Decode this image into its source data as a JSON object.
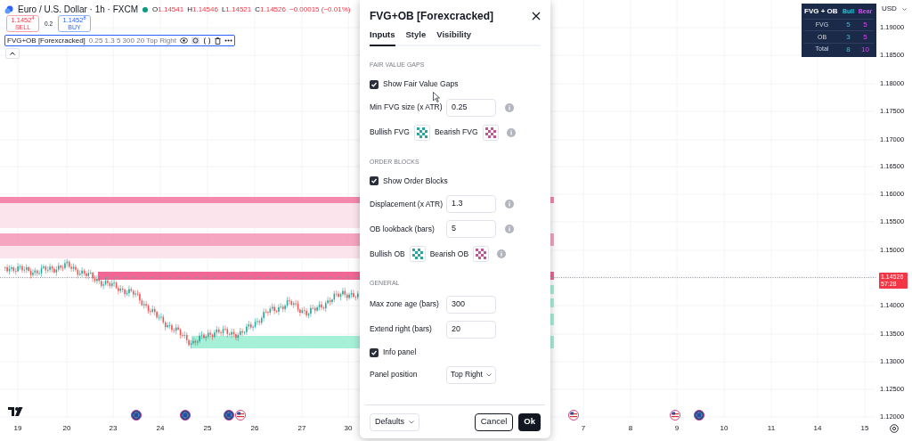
{
  "symbol_header": {
    "title": "Euro / U.S. Dollar · 1h · FXCM",
    "ohlc": [
      {
        "label": "O",
        "value": "1.14541"
      },
      {
        "label": "H",
        "value": "1.14546"
      },
      {
        "label": "L",
        "value": "1.14521"
      },
      {
        "label": "C",
        "value": "1.14526"
      }
    ],
    "change": "−0.00015 (−0.01%)"
  },
  "trade_buttons": {
    "sell": {
      "price": "1.1452$^{4}$",
      "label": "SELL"
    },
    "spread": "0.2",
    "buy": {
      "price": "1.1452$^{8}$",
      "label": "BUY"
    }
  },
  "indicator_legend": {
    "name": "FVG+OB [Forexcracked]",
    "params": "0.25 1.3 5 300 20 Top Right"
  },
  "info_panel": {
    "title": "FVG + OB",
    "columns": [
      {
        "label": "Bull",
        "color": "#26c6da"
      },
      {
        "label": "Bear",
        "color": "#e040fb"
      }
    ],
    "rows": [
      {
        "label": "FVG",
        "bull": "5",
        "bear": "5"
      },
      {
        "label": "OB",
        "bull": "3",
        "bear": "5"
      },
      {
        "label": "Total",
        "bull": "8",
        "bear": "10"
      }
    ]
  },
  "price_axis": {
    "currency": "USD",
    "ticks": [
      "1.19000",
      "1.18500",
      "1.18000",
      "1.17500",
      "1.17000",
      "1.16500",
      "1.16000",
      "1.15500",
      "1.15000",
      "1.14000",
      "1.13500",
      "1.13000",
      "1.12500",
      "1.12000"
    ],
    "last_price": "1.14526",
    "countdown": "57:28"
  },
  "time_axis": {
    "labels": [
      "19",
      "20",
      "23",
      "24",
      "25",
      "26",
      "27",
      "30",
      "7",
      "8",
      "9",
      "10",
      "11",
      "14",
      "15"
    ]
  },
  "dialog": {
    "title": "FVG+OB [Forexcracked]",
    "tabs": [
      {
        "label": "Inputs",
        "selected": true
      },
      {
        "label": "Style",
        "selected": false
      },
      {
        "label": "Visibility",
        "selected": false
      }
    ],
    "sections": [
      {
        "heading": "FAIR VALUE GAPS",
        "rows": [
          {
            "kind": "checkbox",
            "label": "Show Fair Value Gaps",
            "checked": true
          },
          {
            "kind": "input",
            "label": "Min FVG size (x ATR)",
            "value": "0.25",
            "info": true
          },
          {
            "kind": "colors",
            "swatches": [
              {
                "label": "Bullish FVG",
                "color": "#26a69a"
              },
              {
                "label": "Bearish FVG",
                "color": "#c2558f"
              }
            ],
            "info": true
          }
        ]
      },
      {
        "heading": "ORDER BLOCKS",
        "rows": [
          {
            "kind": "checkbox",
            "label": "Show Order Blocks",
            "checked": true
          },
          {
            "kind": "input",
            "label": "Displacement (x ATR)",
            "value": "1.3",
            "info": true
          },
          {
            "kind": "input",
            "label": "OB lookback (bars)",
            "value": "5",
            "info": true
          },
          {
            "kind": "colors",
            "swatches": [
              {
                "label": "Bullish OB",
                "color": "#26a69a"
              },
              {
                "label": "Bearish OB",
                "color": "#c2558f"
              }
            ],
            "info": true
          }
        ]
      },
      {
        "heading": "GENERAL",
        "rows": [
          {
            "kind": "input",
            "label": "Max zone age (bars)",
            "value": "300",
            "info": false
          },
          {
            "kind": "input",
            "label": "Extend right (bars)",
            "value": "20",
            "info": false
          },
          {
            "kind": "checkbox",
            "label": "Info panel",
            "checked": true
          },
          {
            "kind": "select",
            "label": "Panel position",
            "value": "Top Right"
          }
        ]
      }
    ],
    "footer": {
      "defaults": "Defaults",
      "cancel": "Cancel",
      "ok": "Ok"
    }
  }
}
